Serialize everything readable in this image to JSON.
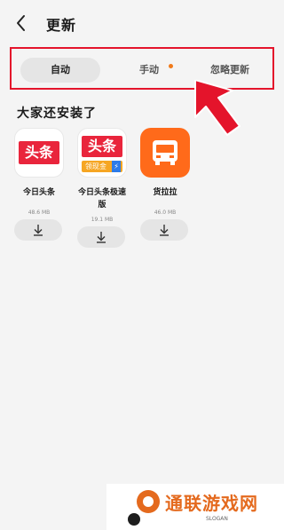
{
  "header": {
    "title": "更新",
    "back_icon": "chevron-left-icon"
  },
  "tabs": [
    {
      "label": "自动",
      "active": true
    },
    {
      "label": "手动",
      "has_dot": true
    },
    {
      "label": "忽略更新"
    }
  ],
  "section": {
    "title": "大家还安装了"
  },
  "apps": [
    {
      "name": "今日头条",
      "size": "48.6 MB",
      "icon_text": "头条"
    },
    {
      "name": "今日头条极速版",
      "size": "19.1 MB",
      "icon_text": "头条",
      "icon_strip": "领现金",
      "icon_badge": "⚡"
    },
    {
      "name": "货拉拉",
      "size": "46.0 MB"
    }
  ],
  "download_icon": "download-icon",
  "watermark": {
    "text": "通联游戏网",
    "slogan": "SLOGAN"
  },
  "colors": {
    "highlight": "#e4142b",
    "dot": "#f07a1a",
    "truck": "#ff6a1a",
    "watermark": "#e46a1e"
  }
}
